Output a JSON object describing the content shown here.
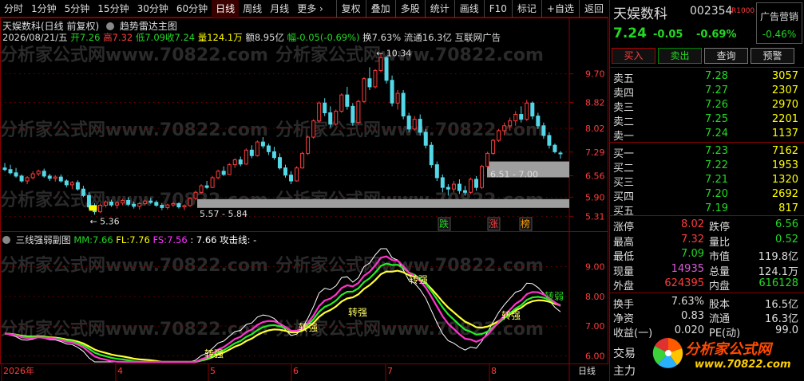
{
  "toolbar": {
    "periods": [
      "分时",
      "1分钟",
      "5分钟",
      "15分钟",
      "30分钟",
      "60分钟",
      "日线",
      "周线",
      "月线",
      "更多"
    ],
    "active_index": 6,
    "more_arrow": "›",
    "actions": [
      "复权",
      "叠加",
      "多股",
      "统计",
      "画线",
      "F10",
      "标记",
      "+自选",
      "返回"
    ]
  },
  "chart_header": {
    "title": "天娱数科(日线 前复权)",
    "indicator_menu": "趋势雷达主图",
    "date": "2026/08/21/五",
    "open_label": "开",
    "open": "7.26",
    "high_label": "高",
    "high": "7.32",
    "low_label": "低",
    "low": "7.09",
    "close_label": "收",
    "close": "7.24",
    "vol_label": "量",
    "vol": "124.1万",
    "amt_label": "额",
    "amt": "8.95亿",
    "chg_label": "幅",
    "chg": "-0.05(-0.69%)",
    "turnover_label": "换",
    "turnover": "7.63%",
    "float_label": "流通",
    "float": "16.3亿",
    "ad": "互联网广告"
  },
  "sub_header": {
    "name": "三线强弱副图",
    "mm_label": "MM:",
    "mm": "7.66",
    "fl_label": "FL:",
    "fl": "7.76",
    "fs_label": "FS:",
    "fs": "7.56",
    "extra": ": 7.66",
    "attack_label": "攻击线: -"
  },
  "watermark": "分析家公式网www.70822.com",
  "chart_data": {
    "type": "candlestick",
    "price_axis": [
      9.7,
      8.82,
      8.02,
      7.29,
      6.56,
      5.9,
      5.31
    ],
    "sub_axis": [
      9.0,
      8.0,
      7.0,
      6.0
    ],
    "x_labels": [
      "2026年",
      "4",
      "5",
      "6",
      "7",
      "8"
    ],
    "period_label": "日线",
    "annotations": {
      "high": "10.34",
      "low": "5.36",
      "zone1": "5.57 - 5.84",
      "zone2": "6.51 - 7.00",
      "sub_markers": [
        "转强",
        "转强",
        "转强",
        "转强",
        "转强",
        "转弱"
      ],
      "signals": [
        "跌",
        "涨",
        "榜"
      ]
    },
    "ohlc": [
      [
        6.8,
        6.95,
        6.7,
        6.75
      ],
      [
        6.75,
        6.9,
        6.6,
        6.65
      ],
      [
        6.65,
        6.8,
        6.5,
        6.55
      ],
      [
        6.55,
        6.6,
        6.35,
        6.4
      ],
      [
        6.4,
        6.55,
        6.3,
        6.5
      ],
      [
        6.5,
        6.7,
        6.45,
        6.62
      ],
      [
        6.62,
        6.75,
        6.55,
        6.7
      ],
      [
        6.7,
        6.78,
        6.5,
        6.55
      ],
      [
        6.55,
        6.62,
        6.4,
        6.48
      ],
      [
        6.48,
        6.58,
        6.38,
        6.52
      ],
      [
        6.52,
        6.6,
        6.35,
        6.4
      ],
      [
        6.4,
        6.45,
        6.2,
        6.28
      ],
      [
        6.28,
        6.4,
        6.15,
        6.35
      ],
      [
        6.35,
        6.42,
        6.1,
        6.15
      ],
      [
        6.15,
        6.25,
        5.9,
        5.95
      ],
      [
        5.95,
        6.05,
        5.55,
        5.6
      ],
      [
        5.6,
        5.72,
        5.36,
        5.45
      ],
      [
        5.45,
        5.7,
        5.42,
        5.65
      ],
      [
        5.65,
        5.8,
        5.58,
        5.75
      ],
      [
        5.75,
        5.82,
        5.6,
        5.66
      ],
      [
        5.66,
        5.78,
        5.55,
        5.72
      ],
      [
        5.72,
        5.85,
        5.65,
        5.8
      ],
      [
        5.8,
        5.9,
        5.62,
        5.68
      ],
      [
        5.68,
        5.76,
        5.55,
        5.62
      ],
      [
        5.62,
        5.75,
        5.52,
        5.7
      ],
      [
        5.7,
        5.82,
        5.64,
        5.78
      ],
      [
        5.78,
        5.88,
        5.7,
        5.74
      ],
      [
        5.74,
        5.8,
        5.6,
        5.65
      ],
      [
        5.65,
        5.72,
        5.5,
        5.58
      ],
      [
        5.58,
        5.7,
        5.52,
        5.66
      ],
      [
        5.66,
        5.76,
        5.6,
        5.7
      ],
      [
        5.7,
        5.74,
        5.55,
        5.6
      ],
      [
        5.6,
        5.68,
        5.5,
        5.64
      ],
      [
        5.64,
        5.9,
        5.6,
        5.86
      ],
      [
        5.86,
        6.1,
        5.8,
        6.05
      ],
      [
        6.05,
        6.3,
        6.0,
        6.25
      ],
      [
        6.25,
        6.4,
        6.15,
        6.2
      ],
      [
        6.2,
        6.55,
        6.18,
        6.5
      ],
      [
        6.5,
        6.75,
        6.45,
        6.7
      ],
      [
        6.7,
        6.85,
        6.55,
        6.6
      ],
      [
        6.6,
        6.95,
        6.58,
        6.9
      ],
      [
        6.9,
        7.1,
        6.8,
        7.05
      ],
      [
        7.05,
        7.15,
        6.85,
        6.92
      ],
      [
        6.92,
        7.4,
        6.9,
        7.35
      ],
      [
        7.35,
        7.5,
        7.1,
        7.18
      ],
      [
        7.18,
        7.65,
        7.15,
        7.6
      ],
      [
        7.6,
        7.75,
        7.4,
        7.48
      ],
      [
        7.48,
        7.55,
        7.2,
        7.3
      ],
      [
        7.3,
        7.45,
        7.05,
        7.12
      ],
      [
        7.12,
        7.25,
        6.75,
        6.8
      ],
      [
        6.8,
        6.9,
        6.5,
        6.58
      ],
      [
        6.58,
        6.7,
        6.3,
        6.4
      ],
      [
        6.4,
        6.85,
        6.38,
        6.8
      ],
      [
        6.8,
        7.3,
        6.78,
        7.25
      ],
      [
        7.25,
        7.8,
        7.2,
        7.75
      ],
      [
        7.75,
        8.3,
        7.7,
        8.25
      ],
      [
        8.25,
        8.85,
        8.2,
        8.8
      ],
      [
        8.8,
        8.95,
        8.4,
        8.5
      ],
      [
        8.5,
        8.7,
        8.05,
        8.15
      ],
      [
        8.15,
        8.6,
        8.1,
        8.55
      ],
      [
        8.55,
        9.1,
        8.5,
        9.05
      ],
      [
        9.05,
        9.3,
        8.6,
        8.7
      ],
      [
        8.7,
        8.8,
        8.1,
        8.2
      ],
      [
        8.2,
        8.9,
        8.15,
        8.85
      ],
      [
        8.85,
        9.6,
        8.8,
        9.55
      ],
      [
        9.55,
        9.9,
        9.2,
        9.3
      ],
      [
        9.3,
        9.85,
        9.25,
        9.8
      ],
      [
        9.8,
        10.34,
        9.75,
        10.2
      ],
      [
        10.2,
        10.25,
        9.4,
        9.5
      ],
      [
        9.5,
        9.65,
        8.7,
        8.8
      ],
      [
        8.8,
        9.2,
        8.6,
        9.1
      ],
      [
        9.1,
        9.2,
        8.3,
        8.4
      ],
      [
        8.4,
        8.5,
        7.9,
        8.0
      ],
      [
        8.0,
        8.4,
        7.95,
        8.3
      ],
      [
        8.3,
        8.45,
        7.8,
        7.9
      ],
      [
        7.9,
        8.0,
        7.4,
        7.5
      ],
      [
        7.5,
        7.6,
        6.8,
        6.9
      ],
      [
        6.9,
        7.0,
        6.4,
        6.5
      ],
      [
        6.5,
        6.6,
        6.05,
        6.2
      ],
      [
        6.2,
        6.3,
        5.95,
        6.15
      ],
      [
        6.15,
        6.4,
        6.05,
        6.3
      ],
      [
        6.3,
        6.45,
        6.0,
        6.1
      ],
      [
        6.1,
        6.25,
        5.95,
        6.05
      ],
      [
        6.05,
        6.5,
        6.0,
        6.45
      ],
      [
        6.45,
        6.55,
        6.1,
        6.2
      ],
      [
        6.2,
        6.9,
        6.15,
        6.85
      ],
      [
        6.85,
        7.3,
        6.8,
        7.25
      ],
      [
        7.25,
        7.7,
        7.2,
        7.65
      ],
      [
        7.65,
        8.0,
        7.6,
        7.95
      ],
      [
        7.95,
        8.2,
        7.8,
        8.1
      ],
      [
        8.1,
        8.35,
        7.95,
        8.25
      ],
      [
        8.25,
        8.55,
        8.1,
        8.45
      ],
      [
        8.45,
        8.7,
        8.2,
        8.3
      ],
      [
        8.3,
        8.9,
        8.25,
        8.8
      ],
      [
        8.8,
        8.85,
        8.3,
        8.4
      ],
      [
        8.4,
        8.5,
        8.0,
        8.1
      ],
      [
        8.1,
        8.2,
        7.7,
        7.8
      ],
      [
        7.8,
        7.9,
        7.4,
        7.5
      ],
      [
        7.5,
        7.55,
        7.25,
        7.3
      ],
      [
        7.26,
        7.32,
        7.09,
        7.24
      ]
    ]
  },
  "panel": {
    "name": "天娱数科",
    "code": "002354",
    "rt_label": "R1000",
    "ad_label": "广告营销",
    "ad_value": "-0.46%",
    "price": "7.24",
    "change": "-0.05",
    "change_pct": "-0.69%",
    "buttons": [
      "买入",
      "卖出",
      "查询",
      "预警"
    ],
    "asks": [
      {
        "label": "卖五",
        "price": "7.28",
        "vol": "3057"
      },
      {
        "label": "卖四",
        "price": "7.27",
        "vol": "2307"
      },
      {
        "label": "卖三",
        "price": "7.26",
        "vol": "2970"
      },
      {
        "label": "卖二",
        "price": "7.25",
        "vol": "2201"
      },
      {
        "label": "卖一",
        "price": "7.24",
        "vol": "1137"
      }
    ],
    "bids": [
      {
        "label": "买一",
        "price": "7.23",
        "vol": "7162"
      },
      {
        "label": "买二",
        "price": "7.22",
        "vol": "1953"
      },
      {
        "label": "买三",
        "price": "7.21",
        "vol": "1320"
      },
      {
        "label": "买四",
        "price": "7.20",
        "vol": "2692"
      },
      {
        "label": "买五",
        "price": "7.19",
        "vol": "817"
      }
    ],
    "stats": [
      {
        "l1": "涨停",
        "v1": "8.02",
        "c1": "#ff3c3c",
        "l2": "跌停",
        "v2": "6.56",
        "c2": "#23d923"
      },
      {
        "l1": "最高",
        "v1": "7.32",
        "c1": "#ff3c3c",
        "l2": "量比",
        "v2": "0.52",
        "c2": "#23d923"
      },
      {
        "l1": "最低",
        "v1": "7.09",
        "c1": "#23d923",
        "l2": "市值",
        "v2": "119.8亿",
        "c2": "#dddddd"
      },
      {
        "l1": "现量",
        "v1": "14935",
        "c1": "#d75bd7",
        "l2": "总量",
        "v2": "124.1万",
        "c2": "#dddddd"
      },
      {
        "l1": "外盘",
        "v1": "624395",
        "c1": "#ff3c3c",
        "l2": "内盘",
        "v2": "616128",
        "c2": "#23d923"
      }
    ],
    "stats2": [
      {
        "l1": "换手",
        "v1": "7.63%",
        "c1": "#dddddd",
        "l2": "股本",
        "v2": "16.5亿",
        "c2": "#dddddd"
      },
      {
        "l1": "净资",
        "v1": "0.83",
        "c1": "#dddddd",
        "l2": "流通",
        "v2": "16.3亿",
        "c2": "#dddddd"
      },
      {
        "l1": "收益(一)",
        "v1": "0.020",
        "c1": "#dddddd",
        "l2": "PE(动)",
        "v2": "99.0",
        "c2": "#dddddd"
      }
    ],
    "bottom1": "交易",
    "bottom2": "主力",
    "logo_text": "分析家公式网",
    "logo_url": "www.70822.com"
  },
  "colors": {
    "up": "#ff3c3c",
    "down": "#23d923",
    "candle_down": "#54d8e8",
    "grid": "#8a0000",
    "zone": "#9e9e9e",
    "line_white": "#ffffff",
    "line_yellow": "#ffff33",
    "line_green": "#22ee22",
    "line_magenta": "#ff33cc"
  }
}
